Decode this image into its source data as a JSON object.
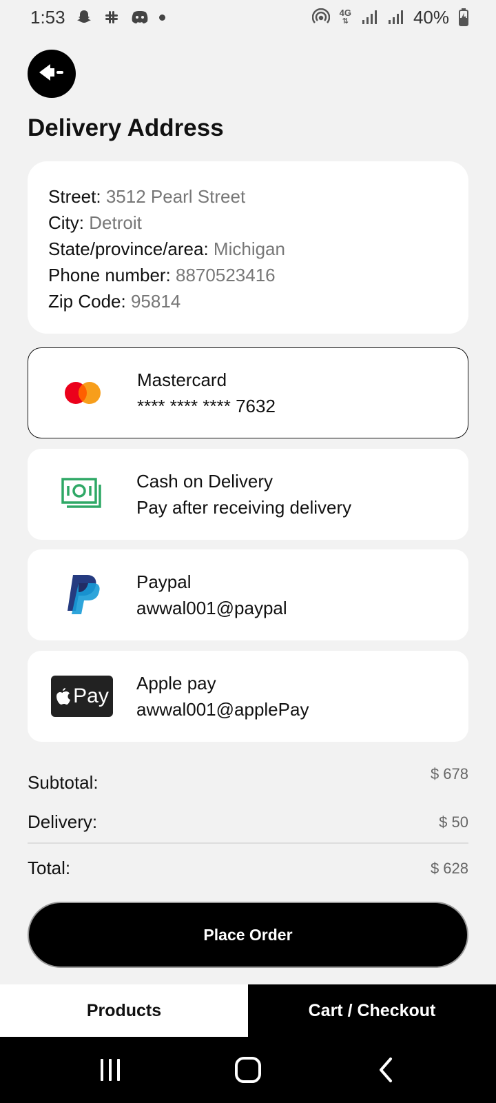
{
  "status_bar": {
    "time": "1:53",
    "battery": "40%",
    "network": "4G"
  },
  "header": {
    "back_icon": "back-arrow-icon",
    "title": "Delivery Address"
  },
  "address": {
    "street_label": "Street: ",
    "street_value": "3512 Pearl Street",
    "city_label": "City: ",
    "city_value": "Detroit",
    "state_label": "State/province/area: ",
    "state_value": "Michigan",
    "phone_label": "Phone number: ",
    "phone_value": "8870523416",
    "zip_label": "Zip Code: ",
    "zip_value": "95814"
  },
  "payment_methods": [
    {
      "icon": "mastercard-icon",
      "title": "Mastercard",
      "detail": "**** **** **** 7632",
      "selected": true
    },
    {
      "icon": "cash-icon",
      "title": "Cash on Delivery",
      "detail": "Pay after receiving delivery",
      "selected": false
    },
    {
      "icon": "paypal-icon",
      "title": "Paypal",
      "detail": "awwal001@paypal",
      "selected": false
    },
    {
      "icon": "apple-pay-icon",
      "title": "Apple pay",
      "detail": "awwal001@applePay",
      "selected": false,
      "badge_text": "Pay"
    }
  ],
  "summary": {
    "subtotal_label": "Subtotal:",
    "subtotal_value": "$ 678",
    "delivery_label": "Delivery:",
    "delivery_value": "$ 50",
    "total_label": "Total:",
    "total_value": "$ 628"
  },
  "actions": {
    "place_order": "Place Order"
  },
  "tabs": {
    "products": "Products",
    "cart": "Cart / Checkout"
  },
  "colors": {
    "accent": "#000000",
    "background": "#f2f2f2",
    "cash_green": "#2fa866",
    "mastercard_red": "#eb001b",
    "mastercard_orange": "#f79e1b",
    "paypal_dark": "#253b80",
    "paypal_light": "#179bd7"
  }
}
